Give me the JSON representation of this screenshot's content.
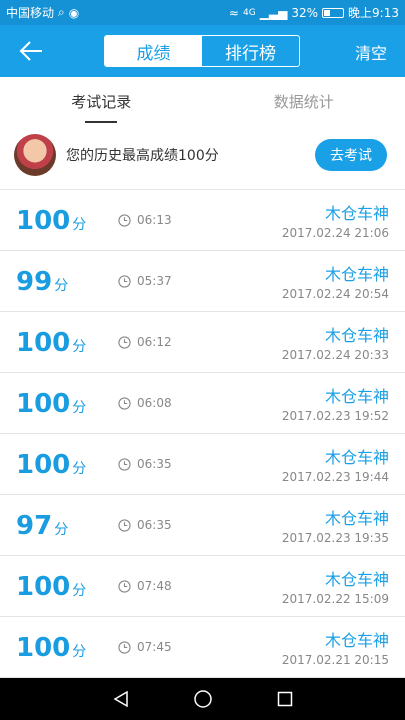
{
  "status": {
    "carrier": "中国移动",
    "battery": "32%",
    "battery_level": 0.32,
    "time": "晚上9:13",
    "network": "4G"
  },
  "header": {
    "tab_scores": "成绩",
    "tab_ranking": "排行榜",
    "clear_label": "清空"
  },
  "tabs": {
    "records": "考试记录",
    "stats": "数据统计"
  },
  "best": {
    "text": "您的历史最高成绩100分",
    "button": "去考试"
  },
  "records": [
    {
      "score": "100",
      "unit": "分",
      "duration": "06:13",
      "user": "木仓车神",
      "datetime": "2017.02.24  21:06"
    },
    {
      "score": "99",
      "unit": "分",
      "duration": "05:37",
      "user": "木仓车神",
      "datetime": "2017.02.24  20:54"
    },
    {
      "score": "100",
      "unit": "分",
      "duration": "06:12",
      "user": "木仓车神",
      "datetime": "2017.02.24  20:33"
    },
    {
      "score": "100",
      "unit": "分",
      "duration": "06:08",
      "user": "木仓车神",
      "datetime": "2017.02.23  19:52"
    },
    {
      "score": "100",
      "unit": "分",
      "duration": "06:35",
      "user": "木仓车神",
      "datetime": "2017.02.23  19:44"
    },
    {
      "score": "97",
      "unit": "分",
      "duration": "06:35",
      "user": "木仓车神",
      "datetime": "2017.02.23  19:35"
    },
    {
      "score": "100",
      "unit": "分",
      "duration": "07:48",
      "user": "木仓车神",
      "datetime": "2017.02.22  15:09"
    },
    {
      "score": "100",
      "unit": "分",
      "duration": "07:45",
      "user": "木仓车神",
      "datetime": "2017.02.21  20:15"
    }
  ]
}
